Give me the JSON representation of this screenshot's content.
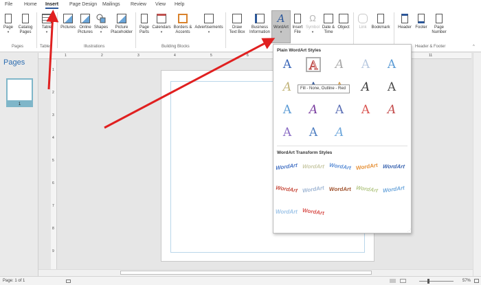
{
  "menu": {
    "tabs": [
      "File",
      "Home",
      "Insert",
      "Page Design",
      "Mailings",
      "Review",
      "View",
      "Help"
    ],
    "active": "Insert"
  },
  "ribbon": {
    "buttons": {
      "page": "Page",
      "catalog_pages_1": "Catalog",
      "catalog_pages_2": "Pages",
      "table": "Table",
      "pictures": "Pictures",
      "online_pictures_1": "Online",
      "online_pictures_2": "Pictures",
      "shapes": "Shapes",
      "picture_placeholder_1": "Picture",
      "picture_placeholder_2": "Placeholder",
      "page_parts_1": "Page",
      "page_parts_2": "Parts",
      "calendars": "Calendars",
      "borders_accents_1": "Borders &",
      "borders_accents_2": "Accents",
      "advertisements": "Advertisements",
      "draw_text_box_1": "Draw",
      "draw_text_box_2": "Text Box",
      "business_info_1": "Business",
      "business_info_2": "Information",
      "wordart": "WordArt",
      "insert_file_1": "Insert",
      "insert_file_2": "File",
      "symbol": "Symbol",
      "date_time_1": "Date &",
      "date_time_2": "Time",
      "object": "Object",
      "link": "Link",
      "bookmark": "Bookmark",
      "header": "Header",
      "footer": "Footer",
      "page_number_1": "Page",
      "page_number_2": "Number"
    },
    "groups": {
      "pages": "Pages",
      "tables": "Tables",
      "illustrations": "Illustrations",
      "building_blocks": "Building Blocks",
      "header_footer": "Header & Footer"
    }
  },
  "pages_pane": {
    "title": "Pages",
    "thumbnail_number": "1"
  },
  "ruler": {
    "h_labels": [
      "1",
      "2",
      "3",
      "4",
      "5",
      "6",
      "7",
      "8",
      "9",
      "10",
      "11"
    ],
    "v_labels": [
      "1",
      "2",
      "3",
      "4",
      "5",
      "6",
      "7",
      "8",
      "9"
    ]
  },
  "wordart_gallery": {
    "plain_heading": "Plain WordArt Styles",
    "transform_heading": "WordArt Transform Styles",
    "glyph": "A",
    "transform_text": "WordArt",
    "tooltip": "Fill - None, Outline - Red",
    "plain_styles": [
      {
        "color": "#3a66b8"
      },
      {
        "color": "#c0504d"
      },
      {
        "color": "#a9a9a9"
      },
      {
        "color": "#b8c9e0"
      },
      {
        "color": "#5b9bd5"
      },
      {
        "color": "#c2b47a"
      },
      {
        "color": "#2f5597"
      },
      {
        "color": "#d39a4a"
      },
      {
        "color": "#3b3b3b"
      },
      {
        "color": "#4a4a4a"
      },
      {
        "color": "#5b9bd5"
      },
      {
        "color": "#7a3fa0"
      },
      {
        "color": "#5b6fb5"
      },
      {
        "color": "#d9534f"
      },
      {
        "color": "#c44d4d"
      },
      {
        "color": "#8a6cc4"
      },
      {
        "color": "#4f7fc2"
      },
      {
        "color": "#6fa8dc"
      }
    ],
    "transform_styles": [
      {
        "color": "#4472c4"
      },
      {
        "color": "#c9c9a6"
      },
      {
        "color": "#5b8ed6"
      },
      {
        "color": "#e69138"
      },
      {
        "color": "#3a64b0"
      },
      {
        "color": "#c84b3d"
      },
      {
        "color": "#9fb6d4"
      },
      {
        "color": "#a0522d"
      },
      {
        "color": "#b6c98a"
      },
      {
        "color": "#6fa8dc"
      },
      {
        "color": "#9fc5e8"
      },
      {
        "color": "#d9534f"
      }
    ]
  },
  "status": {
    "page_indicator": "Page: 1 of 1",
    "zoom": "57%"
  },
  "colors": {
    "accent": "#2b579a",
    "arrow": "#e02020",
    "pages_title": "#2b6cb0",
    "thumb_border": "#7fb6c9"
  }
}
